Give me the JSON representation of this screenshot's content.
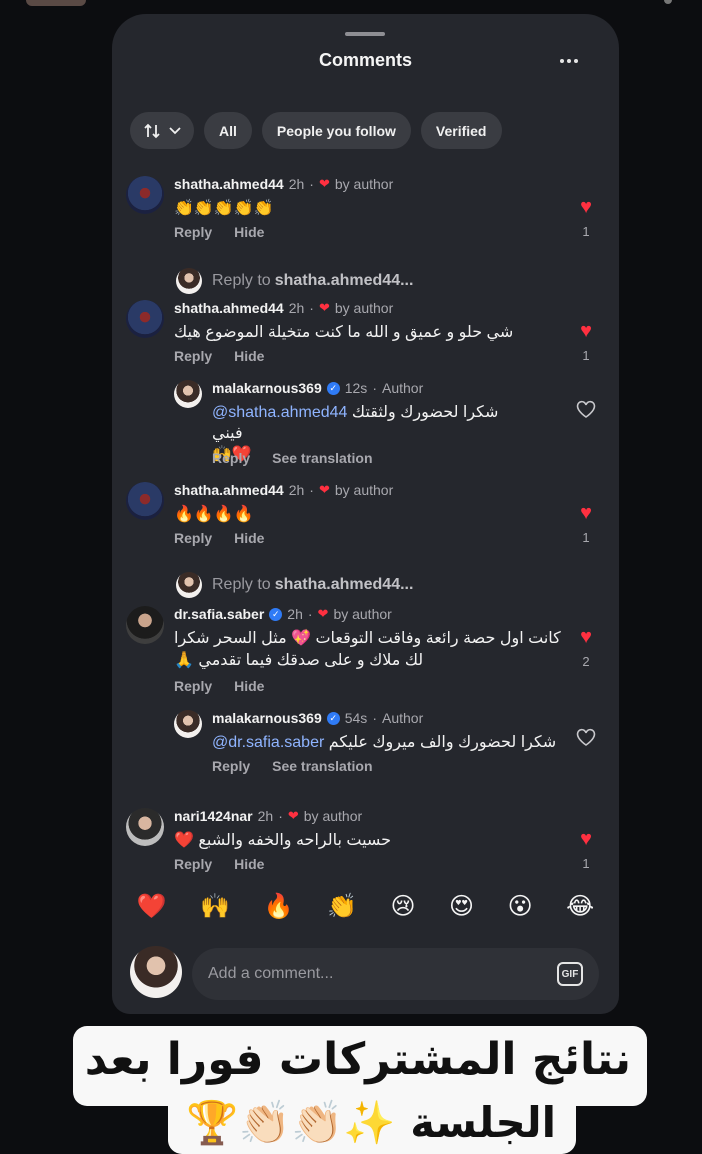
{
  "sheet": {
    "title": "Comments"
  },
  "filters": {
    "all": "All",
    "following": "People you follow",
    "verified": "Verified"
  },
  "comments": [
    {
      "user": "shatha.ahmed44",
      "time": "2h",
      "by": "by author",
      "text": "👏👏👏👏👏",
      "reply": "Reply",
      "hide": "Hide",
      "likes": "1"
    },
    {
      "user": "shatha.ahmed44",
      "time": "2h",
      "by": "by author",
      "text": "شي حلو و عميق و الله ما كنت متخيلة الموضوع هيك",
      "reply": "Reply",
      "hide": "Hide",
      "likes": "1"
    },
    {
      "user": "shatha.ahmed44",
      "time": "2h",
      "by": "by author",
      "text": "🔥🔥🔥🔥",
      "reply": "Reply",
      "hide": "Hide",
      "likes": "1"
    },
    {
      "user": "dr.safia.saber",
      "time": "2h",
      "by": "by author",
      "text_line1": "كانت اول حصة رائعة وفاقت التوقعات 💖 مثل السحر شكرا",
      "text_line2": "لك ملاك و على صدقك فيما تقدمي 🙏",
      "reply": "Reply",
      "hide": "Hide",
      "likes": "2"
    },
    {
      "user": "nari1424nar",
      "time": "2h",
      "by": "by author",
      "text": "حسيت بالراحه والخفه والشبع ❤️",
      "reply": "Reply",
      "hide": "Hide",
      "likes": "1"
    }
  ],
  "replies": [
    {
      "user": "malakarnous369",
      "time": "12s",
      "role": "Author",
      "mention": "@shatha.ahmed44",
      "text": "شكرا لحضورك ولثقتك فيني",
      "text_line2": "🙌❤️",
      "reply": "Reply",
      "translate": "See translation"
    },
    {
      "user": "malakarnous369",
      "time": "54s",
      "role": "Author",
      "mention": "@dr.safia.saber",
      "text": "شكرا لحضورك والف ميروك عليكم",
      "reply": "Reply",
      "translate": "See translation"
    }
  ],
  "reply_prompts": [
    {
      "prefix": "Reply to",
      "target": "shatha.ahmed44..."
    },
    {
      "prefix": "Reply to",
      "target": "shatha.ahmed44..."
    }
  ],
  "reactions": [
    "❤️",
    "🙌",
    "🔥",
    "👏",
    "😢",
    "😍",
    "😮",
    "😂"
  ],
  "compose": {
    "placeholder": "Add a comment...",
    "gif": "GIF"
  },
  "overlay": {
    "line1": "نتائج المشتركات فورا بعد",
    "line2": "الجلسة ✨👏🏻👏🏻🏆"
  },
  "colors": {
    "sheet": "#25272d",
    "heart": "#ff3040",
    "mention": "#8fb4ff",
    "verified": "#2f7bf6"
  }
}
